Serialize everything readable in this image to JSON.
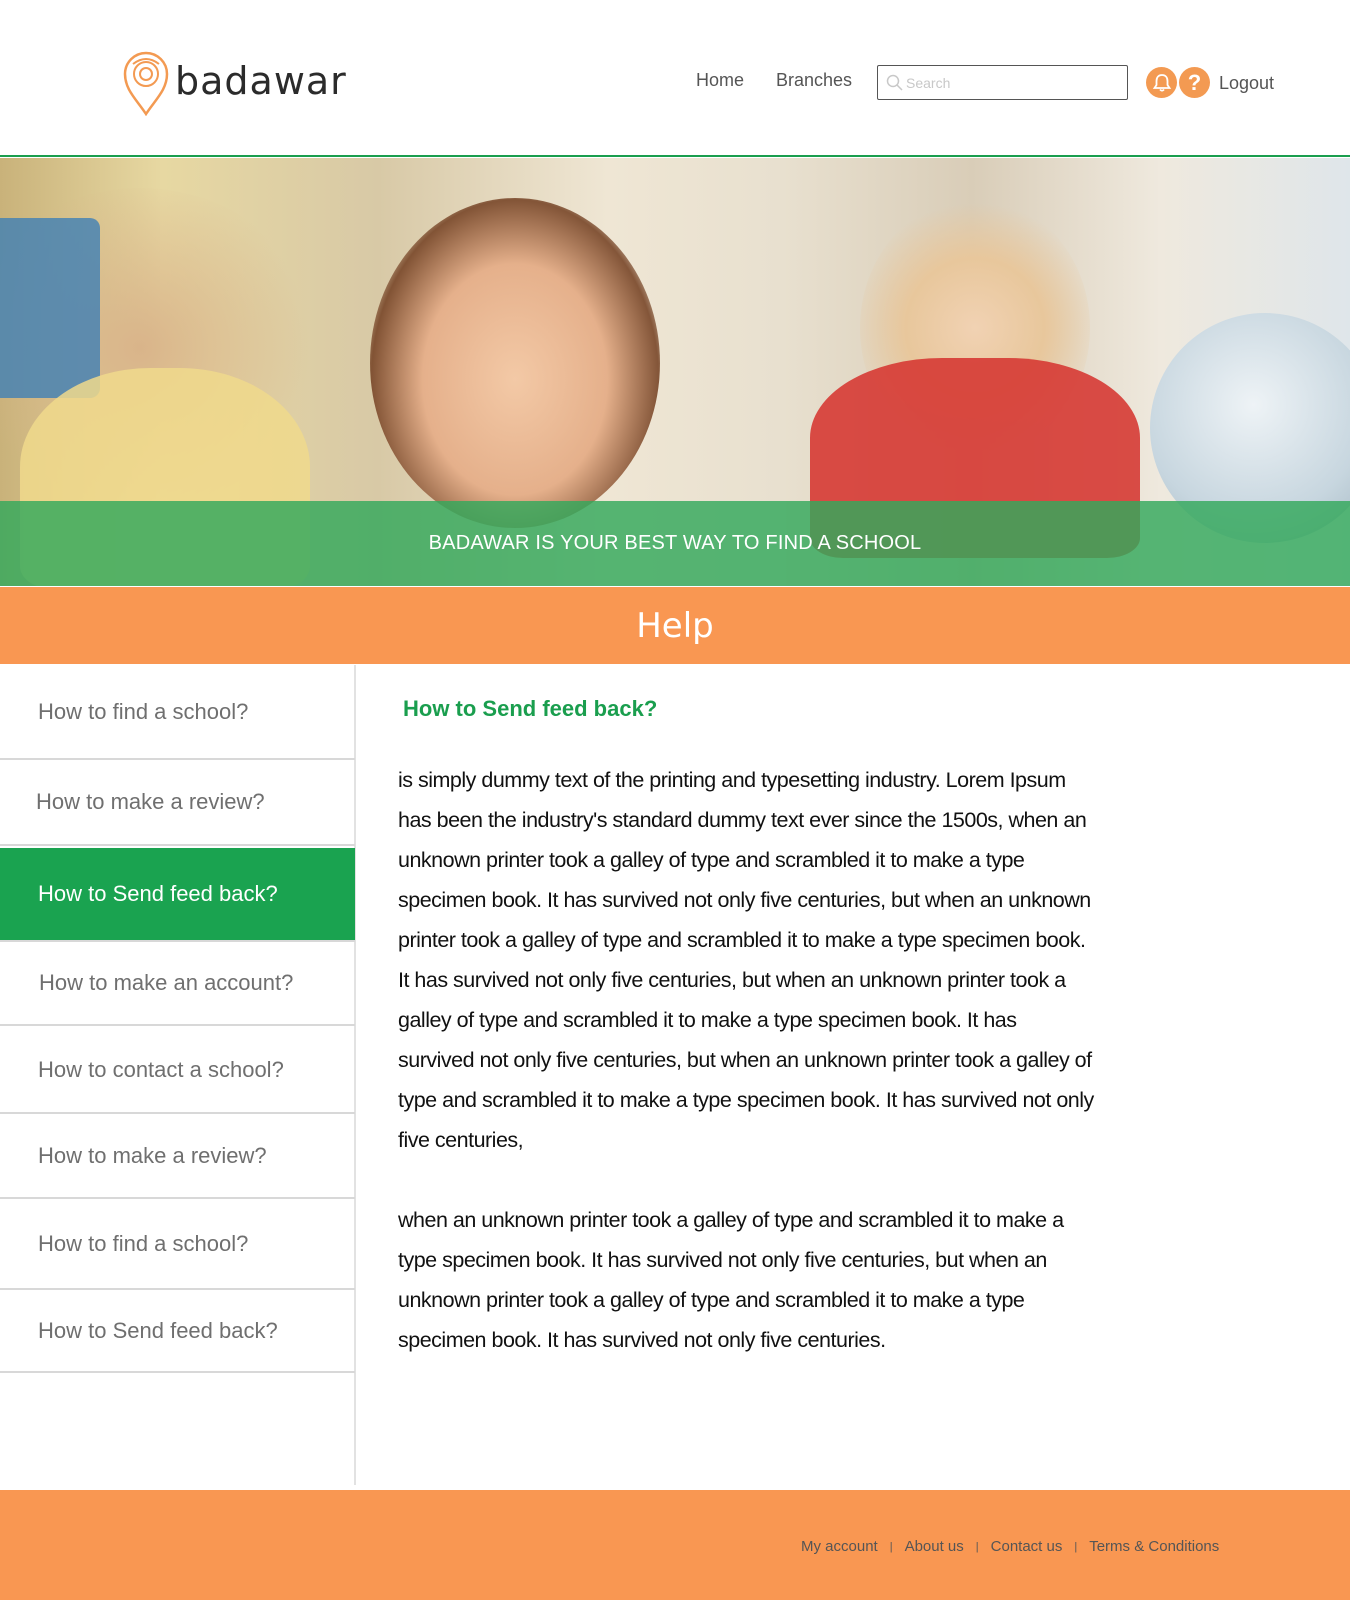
{
  "brand": {
    "name": "badawar",
    "accent": "#1a9e4e",
    "orange": "#f99752"
  },
  "nav": {
    "home": "Home",
    "branches": "Branches",
    "logout": "Logout"
  },
  "search": {
    "placeholder": "Search",
    "value": ""
  },
  "icons": {
    "bell": "bell-icon",
    "help": "question-icon",
    "search": "search-icon",
    "logo": "map-pin-icon"
  },
  "hero": {
    "caption": "BADAWAR IS YOUR BEST WAY TO FIND A SCHOOL"
  },
  "help": {
    "title": "Help"
  },
  "sidebar": {
    "items": [
      {
        "label": "How to find a school?",
        "active": false
      },
      {
        "label": "How to make a review?",
        "active": false
      },
      {
        "label": "How to Send feed back?",
        "active": true
      },
      {
        "label": "How to make an account?",
        "active": false
      },
      {
        "label": "How to contact a school?",
        "active": false
      },
      {
        "label": "How to make a review?",
        "active": false
      },
      {
        "label": "How to find a school?",
        "active": false
      },
      {
        "label": "How to Send feed back?",
        "active": false
      }
    ]
  },
  "content": {
    "title": "How to Send feed back?",
    "paragraph1": " is simply dummy text of the printing and typesetting industry. Lorem Ipsum has been the industry's standard dummy text ever since the 1500s, when an unknown printer took a galley of type and scrambled it to make a type specimen book. It has survived not only five centuries, but when an unknown printer took a galley of type and scrambled it to make a type specimen book. It has survived not only five centuries, but when an unknown printer took a galley of type and scrambled it to make a type specimen book. It has survived not only five centuries, but when an unknown printer took a galley of type and scrambled it to make a type specimen book. It has survived not only five centuries,",
    "paragraph2": "when an unknown printer took a galley of type and scrambled it to make a type specimen book. It has survived not only five centuries, but when an unknown printer took a galley of type and scrambled it to make a type specimen book. It has survived not only five centuries."
  },
  "footer": {
    "links": [
      "My account",
      "About us",
      "Contact us",
      "Terms & Conditions"
    ],
    "separator": "|"
  }
}
